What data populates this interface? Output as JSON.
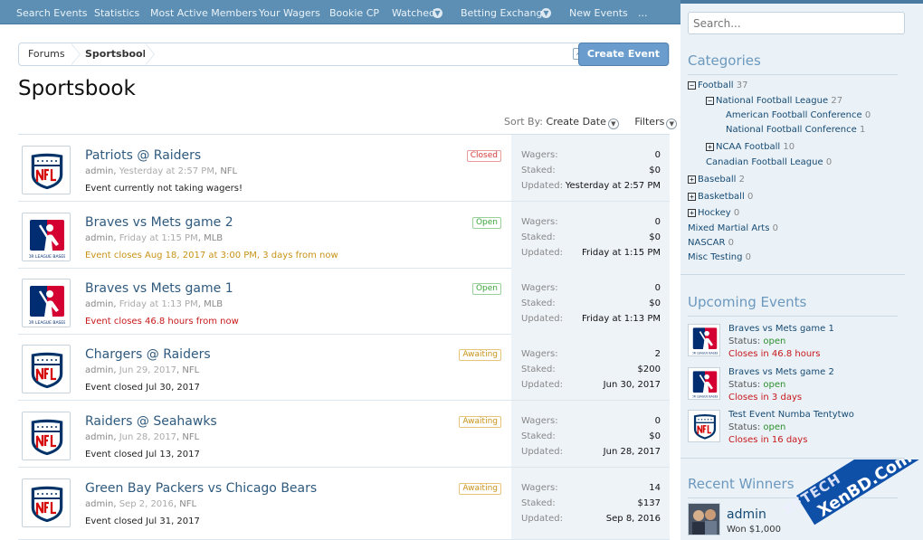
{
  "nav": {
    "items": [
      "Search Events",
      "Statistics",
      "Most Active Members",
      "Your Wagers",
      "Bookie CP",
      "Watched",
      "Betting Exchange",
      "New Events",
      "..."
    ]
  },
  "breadcrumb": [
    "Forums",
    "Sportsbook"
  ],
  "create_button": "Create Event",
  "page_title": "Sportsbook",
  "sort": {
    "label": "Sort By:",
    "value": "Create Date",
    "filters": "Filters"
  },
  "stat_labels": {
    "wagers": "Wagers:",
    "staked": "Staked:",
    "updated": "Updated:"
  },
  "events": [
    {
      "title": "Patriots @ Raiders",
      "user": "admin",
      "date": "Yesterday at 2:57 PM",
      "league": "NFL",
      "badge": "Closed",
      "status": "Event currently not taking wagers!",
      "wagers": "0",
      "staked": "$0",
      "updated": "Yesterday at 2:57 PM",
      "logo": "nfl"
    },
    {
      "title": "Braves vs Mets game 2",
      "user": "admin",
      "date": "Friday at 1:15 PM",
      "league": "MLB",
      "badge": "Open",
      "status": "Event closes Aug 18, 2017 at 3:00 PM, 3 days from now",
      "wagers": "0",
      "staked": "$0",
      "updated": "Friday at 1:15 PM",
      "logo": "mlb"
    },
    {
      "title": "Braves vs Mets game 1",
      "user": "admin",
      "date": "Friday at 1:13 PM",
      "league": "MLB",
      "badge": "Open",
      "status": "Event closes 46.8 hours from now",
      "wagers": "0",
      "staked": "$0",
      "updated": "Friday at 1:13 PM",
      "logo": "mlb"
    },
    {
      "title": "Chargers @ Raiders",
      "user": "admin",
      "date": "Jun 29, 2017",
      "league": "NFL",
      "badge": "Awaiting",
      "status": "Event closed Jul 30, 2017",
      "wagers": "2",
      "staked": "$200",
      "updated": "Jun 30, 2017",
      "logo": "nfl"
    },
    {
      "title": "Raiders @ Seahawks",
      "user": "admin",
      "date": "Jun 28, 2017",
      "league": "NFL",
      "badge": "Awaiting",
      "status": "Event closed Jul 13, 2017",
      "wagers": "0",
      "staked": "$0",
      "updated": "Jun 28, 2017",
      "logo": "nfl"
    },
    {
      "title": "Green Bay Packers vs Chicago Bears",
      "user": "admin",
      "date": "Sep 2, 2016",
      "league": "NFL",
      "badge": "Awaiting",
      "status": "Event closed Jul 31, 2017",
      "wagers": "14",
      "staked": "$137",
      "updated": "Sep 8, 2016",
      "logo": "nfl"
    }
  ],
  "sidebar": {
    "search_placeholder": "Search...",
    "categories_title": "Categories",
    "categories": [
      {
        "label": "Football",
        "count": "37",
        "toggle": "−"
      },
      {
        "label": "National Football League",
        "count": "27",
        "toggle": "−"
      },
      {
        "label": "American Football Conference",
        "count": "0",
        "toggle": ""
      },
      {
        "label": "National Football Conference",
        "count": "1",
        "toggle": ""
      },
      {
        "label": "NCAA Football",
        "count": "10",
        "toggle": "+"
      },
      {
        "label": "Canadian Football League",
        "count": "0",
        "toggle": ""
      },
      {
        "label": "Baseball",
        "count": "2",
        "toggle": "+"
      },
      {
        "label": "Basketball",
        "count": "0",
        "toggle": "+"
      },
      {
        "label": "Hockey",
        "count": "0",
        "toggle": "+"
      },
      {
        "label": "Mixed Martial Arts",
        "count": "0",
        "toggle": ""
      },
      {
        "label": "NASCAR",
        "count": "0",
        "toggle": ""
      },
      {
        "label": "Misc Testing",
        "count": "0",
        "toggle": ""
      }
    ],
    "upcoming_title": "Upcoming Events",
    "status_label": "Status:",
    "upcoming": [
      {
        "title": "Braves vs Mets game 1",
        "status": "open",
        "closes": "Closes in 46.8 hours",
        "logo": "mlb"
      },
      {
        "title": "Braves vs Mets game 2",
        "status": "open",
        "closes": "Closes in 3 days",
        "logo": "mlb"
      },
      {
        "title": "Test Event Numba Tentytwo",
        "status": "open",
        "closes": "Closes in 16 days",
        "logo": "nfl"
      }
    ],
    "winners_title": "Recent Winners",
    "winner": {
      "name": "admin",
      "amount": "Won $1,000"
    }
  },
  "watermark": {
    "line1": "XenBD.Com",
    "line2": "XFTECH"
  },
  "colors": {
    "nav_bg": "#5d8fb4",
    "accent": "#2f5a7e",
    "open": "#3aa53a",
    "closed": "#d43a3a",
    "awaiting": "#c89317",
    "sidebar_bg": "#eaf2f8"
  }
}
